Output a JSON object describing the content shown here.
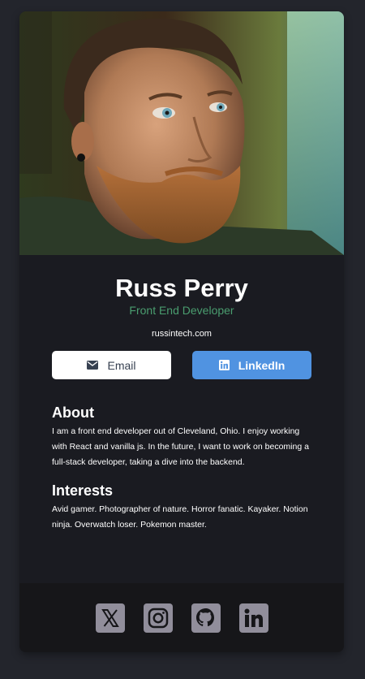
{
  "profile": {
    "name": "Russ Perry",
    "title": "Front End Developer",
    "website": "russintech.com"
  },
  "buttons": {
    "email_label": "Email",
    "email_icon": "envelope-icon",
    "linkedin_label": "LinkedIn",
    "linkedin_icon": "linkedin-icon"
  },
  "about": {
    "heading": "About",
    "text": "I am a front end developer out of Cleveland, Ohio. I enjoy working with React and vanilla js. In the future, I want to work on becoming a full-stack developer, taking a dive into the backend."
  },
  "interests": {
    "heading": "Interests",
    "text": "Avid gamer. Photographer of nature. Horror fanatic. Kayaker. Notion ninja. Overwatch loser. Pokemon master."
  },
  "footer": {
    "social": [
      "x-icon",
      "instagram-icon",
      "github-icon",
      "linkedin-icon"
    ]
  },
  "colors": {
    "page_bg": "#23252c",
    "card_bg": "#1a1b21",
    "footer_bg": "#161619",
    "accent_green": "#4a9d6f",
    "linkedin_blue": "#5093e1",
    "social_icon": "#918e9b"
  }
}
